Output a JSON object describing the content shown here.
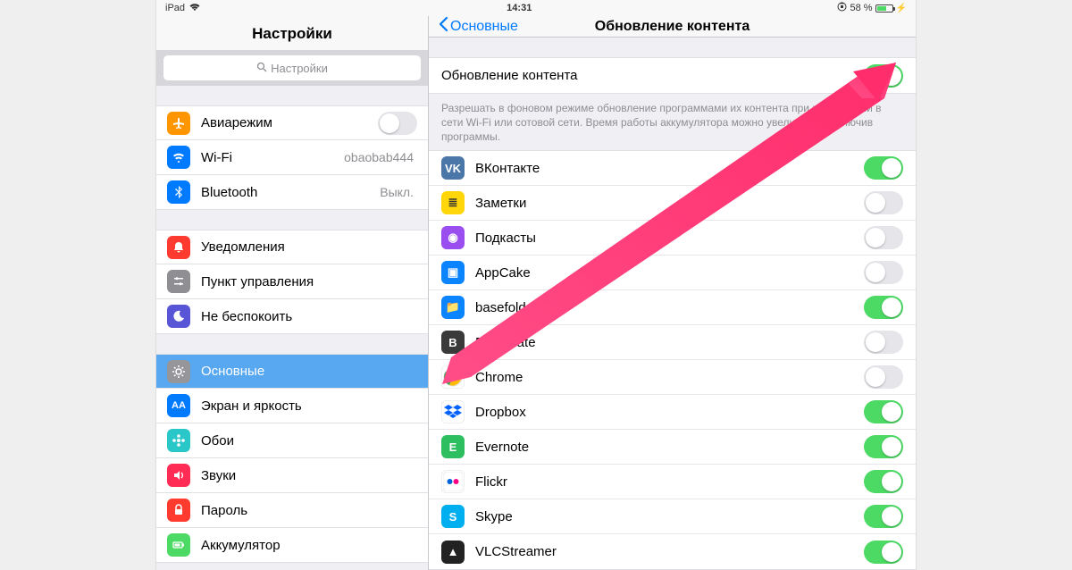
{
  "statusbar": {
    "device": "iPad",
    "time": "14:31",
    "battery_text": "58 %"
  },
  "left": {
    "title": "Настройки",
    "search_placeholder": "Настройки",
    "items": [
      {
        "id": "airplane",
        "label": "Авиарежим",
        "icon": "airplane",
        "color": "#ff9500",
        "toggle": false
      },
      {
        "id": "wifi",
        "label": "Wi-Fi",
        "icon": "wifi",
        "color": "#007aff",
        "detail": "obaobab444"
      },
      {
        "id": "bluetooth",
        "label": "Bluetooth",
        "icon": "bluetooth",
        "color": "#007aff",
        "detail": "Выкл."
      }
    ],
    "items2": [
      {
        "id": "notifications",
        "label": "Уведомления",
        "icon": "bell",
        "color": "#ff3b30"
      },
      {
        "id": "control-center",
        "label": "Пункт управления",
        "icon": "sliders",
        "color": "#8e8e93"
      },
      {
        "id": "dnd",
        "label": "Не беспокоить",
        "icon": "moon",
        "color": "#5856d6"
      }
    ],
    "items3": [
      {
        "id": "general",
        "label": "Основные",
        "icon": "gear",
        "color": "#8e8e93",
        "selected": true
      },
      {
        "id": "display",
        "label": "Экран и яркость",
        "icon": "AA",
        "color": "#007aff"
      },
      {
        "id": "wallpaper",
        "label": "Обои",
        "icon": "flower",
        "color": "#2ac7c9"
      },
      {
        "id": "sounds",
        "label": "Звуки",
        "icon": "speaker",
        "color": "#ff2d55"
      },
      {
        "id": "passcode",
        "label": "Пароль",
        "icon": "lock",
        "color": "#ff3b30"
      },
      {
        "id": "battery",
        "label": "Аккумулятор",
        "icon": "battery",
        "color": "#4cd964"
      }
    ]
  },
  "right": {
    "back_label": "Основные",
    "title": "Обновление контента",
    "master_label": "Обновление контента",
    "master_on": true,
    "footnote": "Разрешать в фоновом режиме обновление программами их контента при нахождении в сети Wi-Fi или сотовой сети. Время работы аккумулятора можно увеличить, выключив программы.",
    "apps": [
      {
        "id": "vk",
        "label": "ВКонтакте",
        "color": "#4a76a8",
        "glyph": "VK",
        "on": true
      },
      {
        "id": "notes",
        "label": "Заметки",
        "color": "#ffd60a",
        "glyph": "≣",
        "on": false
      },
      {
        "id": "podcasts",
        "label": "Подкасты",
        "color": "#9a4ef0",
        "glyph": "◉",
        "on": false
      },
      {
        "id": "appcake",
        "label": "AppCake",
        "color": "#0a84ff",
        "glyph": "▣",
        "on": false
      },
      {
        "id": "basefolder",
        "label": "basefolder",
        "color": "#0a84ff",
        "glyph": "📁",
        "on": true
      },
      {
        "id": "bookmate",
        "label": "Bookmate",
        "color": "#3a3a3a",
        "glyph": "B",
        "on": false
      },
      {
        "id": "chrome",
        "label": "Chrome",
        "color": "#ffffff",
        "glyph": "chrome",
        "on": false
      },
      {
        "id": "dropbox",
        "label": "Dropbox",
        "color": "#ffffff",
        "glyph": "dropbox",
        "on": true
      },
      {
        "id": "evernote",
        "label": "Evernote",
        "color": "#2dbe60",
        "glyph": "E",
        "on": true
      },
      {
        "id": "flickr",
        "label": "Flickr",
        "color": "#ffffff",
        "glyph": "flickr",
        "on": true
      },
      {
        "id": "skype",
        "label": "Skype",
        "color": "#00aff0",
        "glyph": "S",
        "on": true
      },
      {
        "id": "vlc",
        "label": "VLCStreamer",
        "color": "#222",
        "glyph": "▲",
        "on": true
      }
    ]
  }
}
